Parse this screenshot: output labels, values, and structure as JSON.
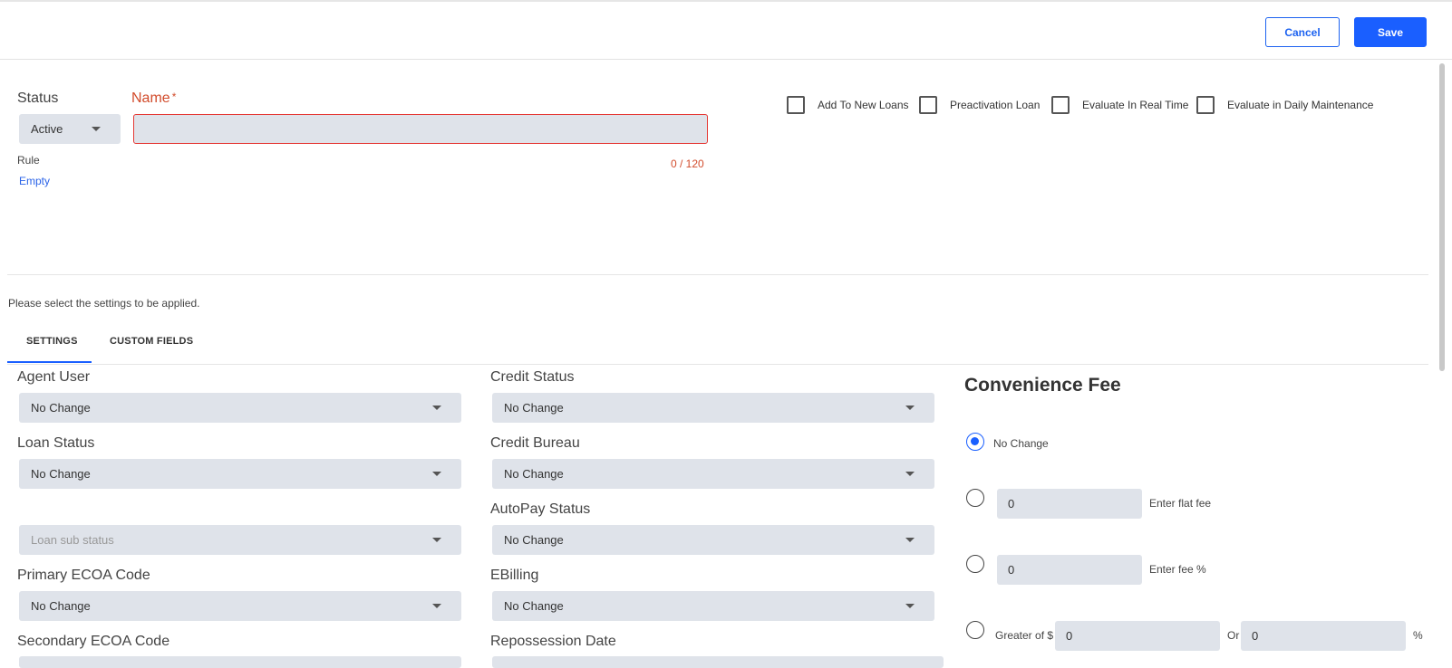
{
  "toolbar": {
    "cancel_label": "Cancel",
    "save_label": "Save"
  },
  "header": {
    "status_label": "Status",
    "status_value": "Active",
    "name_label": "Name",
    "name_required_mark": "*",
    "name_value": "",
    "name_counter": "0 / 120",
    "rule_label": "Rule",
    "rule_value": "Empty"
  },
  "options": [
    {
      "label": "Add To New Loans",
      "checked": false
    },
    {
      "label": "Preactivation Loan",
      "checked": false
    },
    {
      "label": "Evaluate In Real Time",
      "checked": false
    },
    {
      "label": "Evaluate in Daily Maintenance",
      "checked": false
    }
  ],
  "instructions": "Please select the settings to be applied.",
  "tabs": [
    {
      "label": "SETTINGS",
      "active": true
    },
    {
      "label": "CUSTOM FIELDS",
      "active": false
    }
  ],
  "settings": {
    "agent_user": {
      "label": "Agent User",
      "value": "No Change"
    },
    "loan_status": {
      "label": "Loan Status",
      "value": "No Change"
    },
    "loan_sub_status": {
      "placeholder": "Loan sub status"
    },
    "primary_ecoa": {
      "label": "Primary ECOA Code",
      "value": "No Change"
    },
    "secondary_ecoa": {
      "label": "Secondary ECOA Code"
    },
    "credit_status": {
      "label": "Credit Status",
      "value": "No Change"
    },
    "credit_bureau": {
      "label": "Credit Bureau",
      "value": "No Change"
    },
    "autopay_status": {
      "label": "AutoPay Status",
      "value": "No Change"
    },
    "ebilling": {
      "label": "EBilling",
      "value": "No Change"
    },
    "repossession_date": {
      "label": "Repossession Date"
    }
  },
  "convenience_fee": {
    "title": "Convenience Fee",
    "selected": "no_change",
    "no_change_label": "No Change",
    "flat_fee_value": "0",
    "flat_fee_label": "Enter flat fee",
    "percent_fee_value": "0",
    "percent_fee_label": "Enter fee %",
    "greater_of_label": "Greater of $",
    "greater_of_amount": "0",
    "or_label": "Or",
    "greater_of_percent": "0",
    "percent_sign": "%"
  }
}
